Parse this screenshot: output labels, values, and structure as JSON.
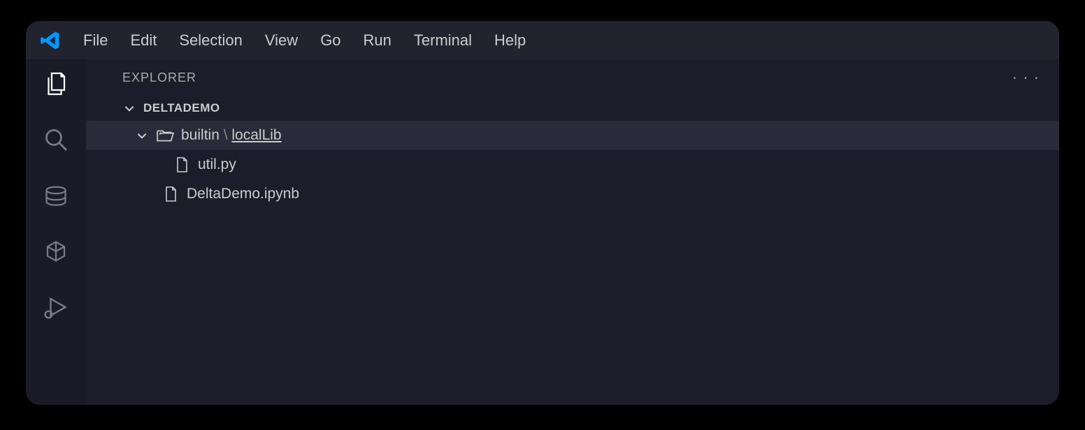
{
  "menubar": {
    "items": [
      "File",
      "Edit",
      "Selection",
      "View",
      "Go",
      "Run",
      "Terminal",
      "Help"
    ]
  },
  "explorer": {
    "title": "EXPLORER",
    "project": "DELTADEMO",
    "tree": {
      "folder": {
        "prefix": "builtin",
        "separator": " \\ ",
        "name": "localLib"
      },
      "file1": "util.py",
      "file2": "DeltaDemo.ipynb"
    }
  }
}
